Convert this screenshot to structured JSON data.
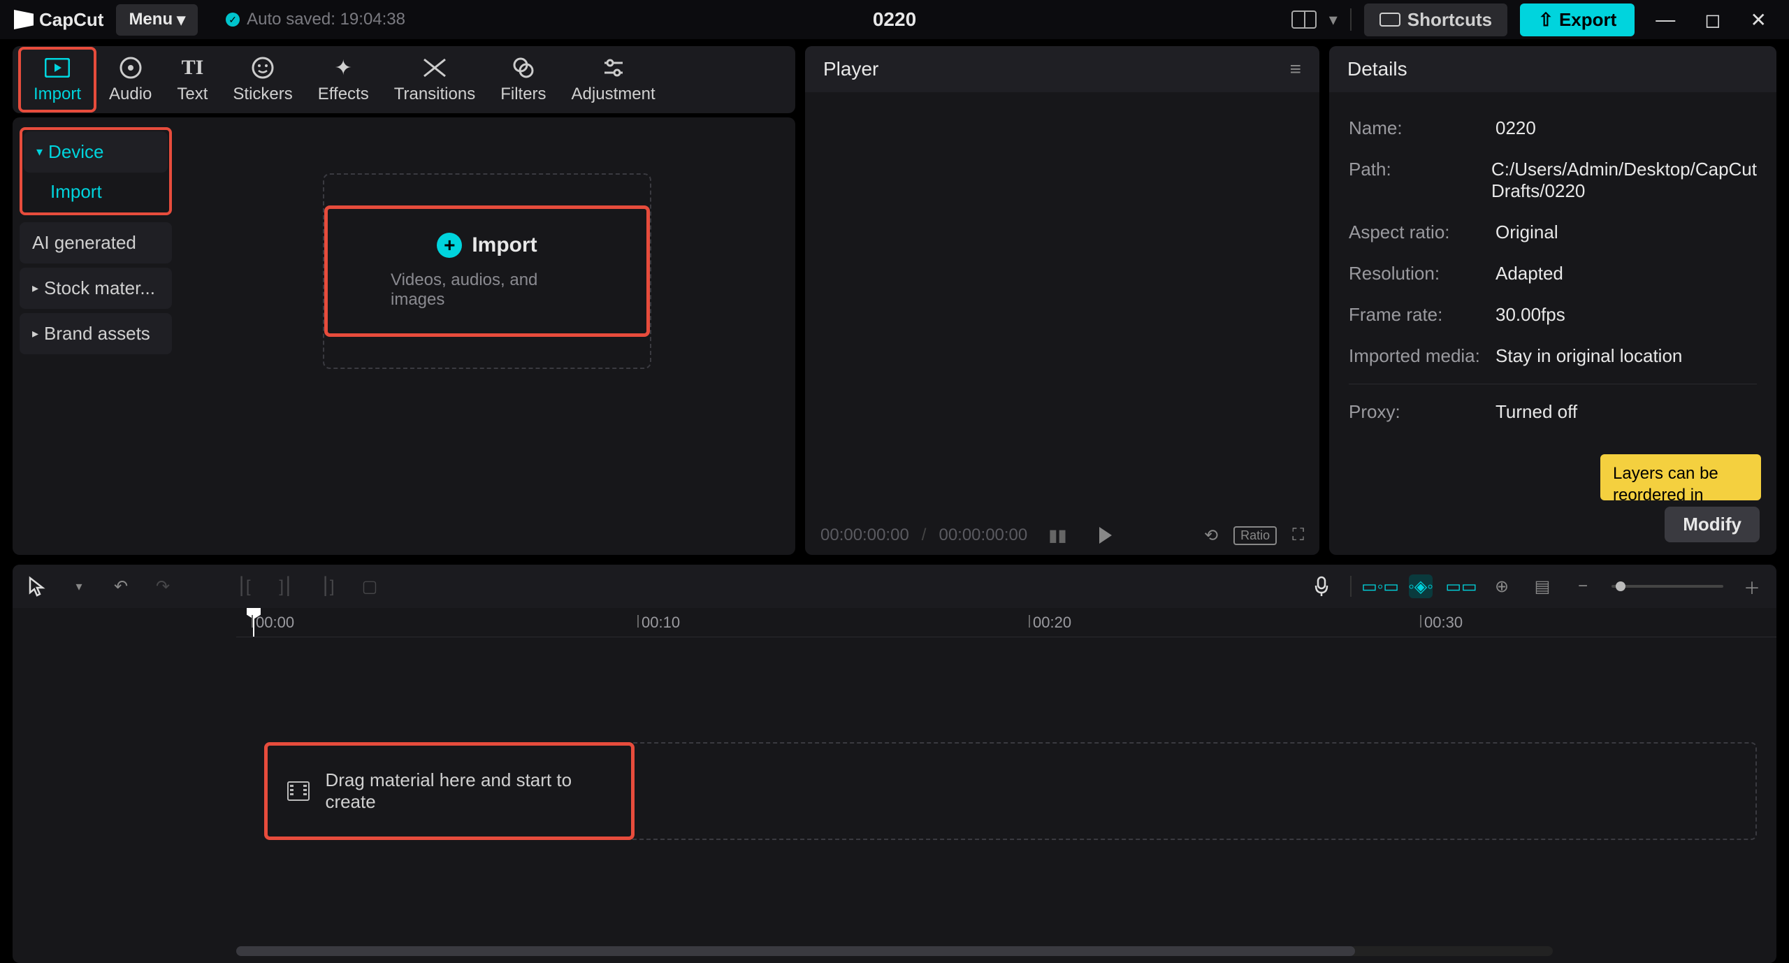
{
  "app": {
    "name": "CapCut",
    "menu": "Menu",
    "autosave": "Auto saved: 19:04:38",
    "project": "0220"
  },
  "titlebar": {
    "shortcuts": "Shortcuts",
    "export": "Export"
  },
  "tabs": {
    "import": "Import",
    "audio": "Audio",
    "text": "Text",
    "stickers": "Stickers",
    "effects": "Effects",
    "transitions": "Transitions",
    "filters": "Filters",
    "adjustment": "Adjustment"
  },
  "sidebar": {
    "device": "Device",
    "import": "Import",
    "ai": "AI generated",
    "stock": "Stock mater...",
    "brand": "Brand assets"
  },
  "importCard": {
    "title": "Import",
    "sub": "Videos, audios, and images"
  },
  "player": {
    "title": "Player",
    "tc1": "00:00:00:00",
    "tc2": "00:00:00:00",
    "ratio": "Ratio"
  },
  "details": {
    "title": "Details",
    "rows": {
      "name_l": "Name:",
      "name_v": "0220",
      "path_l": "Path:",
      "path_v": "C:/Users/Admin/Desktop/CapCut Drafts/0220",
      "ar_l": "Aspect ratio:",
      "ar_v": "Original",
      "res_l": "Resolution:",
      "res_v": "Adapted",
      "fr_l": "Frame rate:",
      "fr_v": "30.00fps",
      "im_l": "Imported media:",
      "im_v": "Stay in original location",
      "px_l": "Proxy:",
      "px_v": "Turned off"
    },
    "tooltip": "Layers can be reordered in",
    "modify": "Modify"
  },
  "timeline": {
    "ticks": [
      "00:00",
      "00:10",
      "00:20",
      "00:30"
    ],
    "drop": "Drag material here and start to create"
  }
}
